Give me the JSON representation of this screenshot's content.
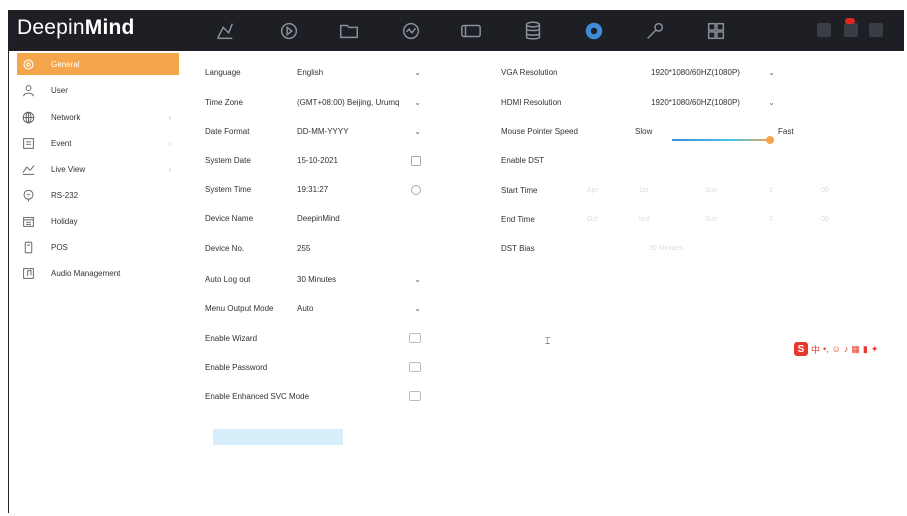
{
  "app": {
    "brand_light": "Deepin",
    "brand_bold": "Mind"
  },
  "topbar": {
    "icons": [
      "live-view-icon",
      "playback-icon",
      "file-icon",
      "smart-icon",
      "camera-icon",
      "storage-icon",
      "settings-icon",
      "maintenance-icon",
      "apps-icon"
    ],
    "active": "settings-icon"
  },
  "sidebar": {
    "items": [
      {
        "label": "General",
        "icon": "gear-icon",
        "active": true
      },
      {
        "label": "User",
        "icon": "user-icon"
      },
      {
        "label": "Network",
        "icon": "globe-icon",
        "arrow": "›"
      },
      {
        "label": "Event",
        "icon": "event-icon",
        "arrow": "›"
      },
      {
        "label": "Live View",
        "icon": "live-view-icon",
        "arrow": "›"
      },
      {
        "label": "RS-232",
        "icon": "serial-icon"
      },
      {
        "label": "Holiday",
        "icon": "calendar-icon"
      },
      {
        "label": "POS",
        "icon": "pos-icon"
      },
      {
        "label": "Audio Management",
        "icon": "audio-icon"
      }
    ]
  },
  "left_form": {
    "language": {
      "label": "Language",
      "value": "English"
    },
    "time_zone": {
      "label": "Time Zone",
      "value": "(GMT+08:00) Beijing, Urumq"
    },
    "date_format": {
      "label": "Date Format",
      "value": "DD-MM-YYYY"
    },
    "system_date": {
      "label": "System Date",
      "value": "15-10-2021"
    },
    "system_time": {
      "label": "System Time",
      "value": "19:31:27"
    },
    "device_name": {
      "label": "Device Name",
      "value": "DeepinMind"
    },
    "device_no": {
      "label": "Device No.",
      "value": "255"
    },
    "auto_logout": {
      "label": "Auto Log out",
      "value": "30 Minutes"
    },
    "menu_output_mode": {
      "label": "Menu Output Mode",
      "value": "Auto"
    },
    "enable_wizard": {
      "label": "Enable Wizard"
    },
    "enable_password": {
      "label": "Enable Password"
    },
    "enable_svc": {
      "label": "Enable Enhanced SVC Mode"
    }
  },
  "right_form": {
    "vga_resolution": {
      "label": "VGA Resolution",
      "value": "1920*1080/60HZ(1080P)"
    },
    "hdmi_resolution": {
      "label": "HDMI Resolution",
      "value": "1920*1080/60HZ(1080P)"
    },
    "mouse_speed": {
      "label": "Mouse Pointer Speed",
      "slow": "Slow",
      "fast": "Fast"
    },
    "enable_dst": {
      "label": "Enable DST"
    },
    "start_time": {
      "label": "Start Time",
      "parts": [
        "Apr",
        "1st",
        "Sun",
        "2",
        "00"
      ]
    },
    "end_time": {
      "label": "End Time",
      "parts": [
        "Oct",
        "last",
        "Sun",
        "2",
        "00"
      ]
    },
    "dst_bias": {
      "label": "DST Bias",
      "value": "30 Minutes"
    }
  },
  "ime": {
    "logo": "S",
    "glyph": "中"
  },
  "colors": {
    "accent": "#f5a54a",
    "topbar": "#1d1f24",
    "active_icon": "#3d8bd9",
    "apply": "#d6effa"
  }
}
